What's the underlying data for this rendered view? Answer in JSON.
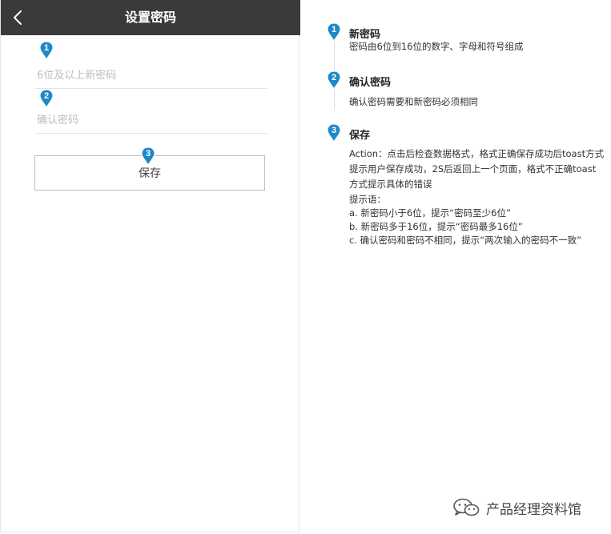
{
  "navbar": {
    "title": "设置密码"
  },
  "form": {
    "new_password_placeholder": "6位及以上新密码",
    "confirm_password_placeholder": "确认密码",
    "save_label": "保存"
  },
  "markers": [
    "1",
    "2",
    "3"
  ],
  "notes": [
    {
      "num": "1",
      "title": "新密码",
      "text": "密码由6位到16位的数字、字母和符号组成"
    },
    {
      "num": "2",
      "title": "确认密码",
      "text": "确认密码需要和新密码必须相同"
    },
    {
      "num": "3",
      "title": "保存",
      "lines": [
        "Action：点击后检查数据格式，格式正确保存成功后toast方式",
        "提示用户保存成功，2S后返回上一个页面，格式不正确toast",
        "方式提示具体的错误",
        "提示语：",
        "a. 新密码小于6位，提示“密码至少6位”",
        "b. 新密码多于16位，提示“密码最多16位”",
        "c. 确认密码和密码不相同，提示“两次输入的密码不一致”"
      ]
    }
  ],
  "watermark": {
    "text": "产品经理资料馆",
    "icon": "wechat-icon"
  },
  "colors": {
    "navbar": "#3a3a3a",
    "marker": "#1e88c9"
  }
}
